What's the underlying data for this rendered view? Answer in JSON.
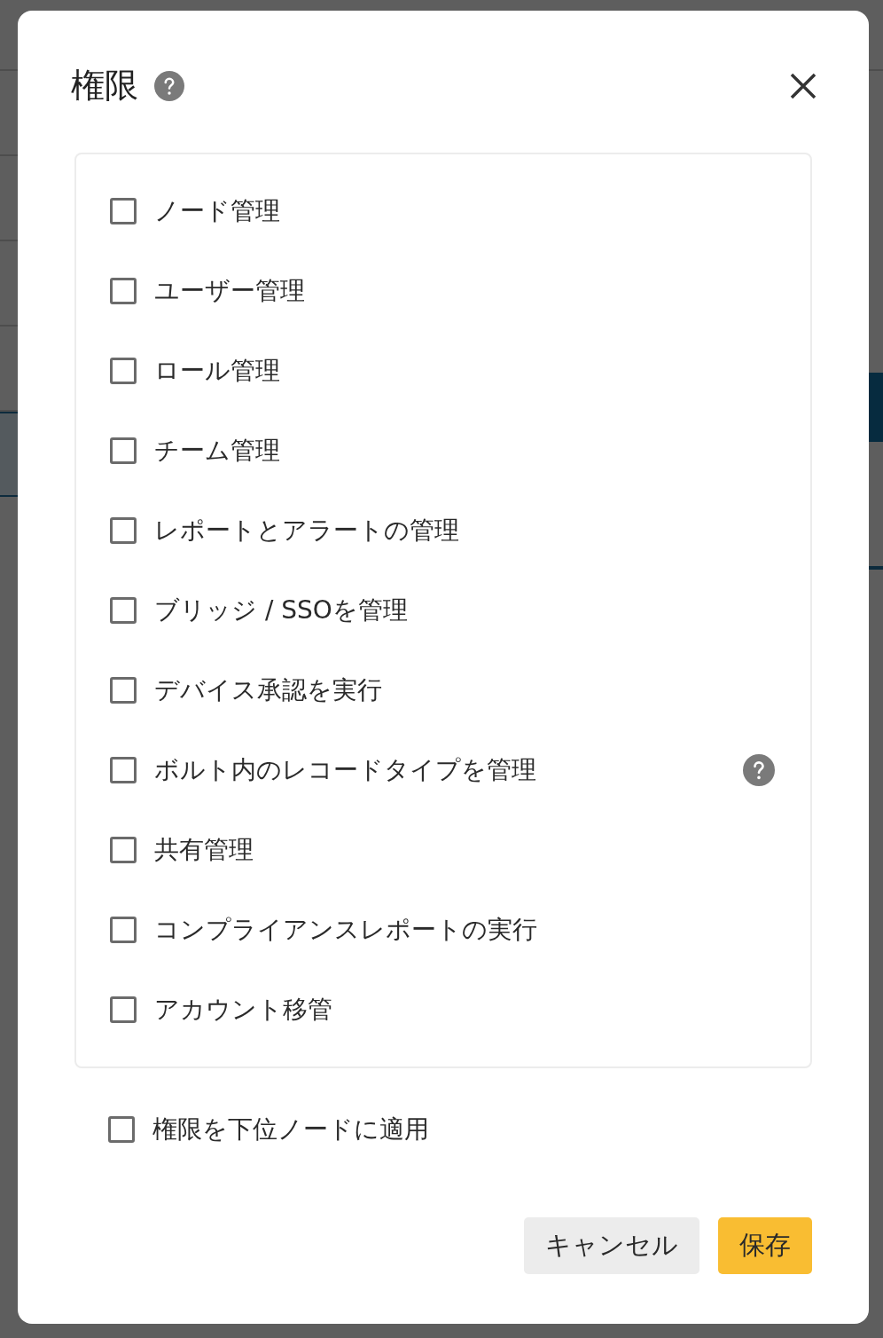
{
  "dialog": {
    "title": "権限",
    "help": true,
    "permissions": [
      {
        "label": "ノード管理",
        "checked": false,
        "help": false
      },
      {
        "label": "ユーザー管理",
        "checked": false,
        "help": false
      },
      {
        "label": "ロール管理",
        "checked": false,
        "help": false
      },
      {
        "label": "チーム管理",
        "checked": false,
        "help": false
      },
      {
        "label": "レポートとアラートの管理",
        "checked": false,
        "help": false
      },
      {
        "label": "ブリッジ / SSOを管理",
        "checked": false,
        "help": false
      },
      {
        "label": "デバイス承認を実行",
        "checked": false,
        "help": false
      },
      {
        "label": "ボルト内のレコードタイプを管理",
        "checked": false,
        "help": true
      },
      {
        "label": "共有管理",
        "checked": false,
        "help": false
      },
      {
        "label": "コンプライアンスレポートの実行",
        "checked": false,
        "help": false
      },
      {
        "label": "アカウント移管",
        "checked": false,
        "help": false
      }
    ],
    "apply_to_subnodes": {
      "label": "権限を下位ノードに適用",
      "checked": false
    },
    "buttons": [
      {
        "label": "キャンセル",
        "kind": "secondary"
      },
      {
        "label": "保存",
        "kind": "primary"
      }
    ]
  }
}
